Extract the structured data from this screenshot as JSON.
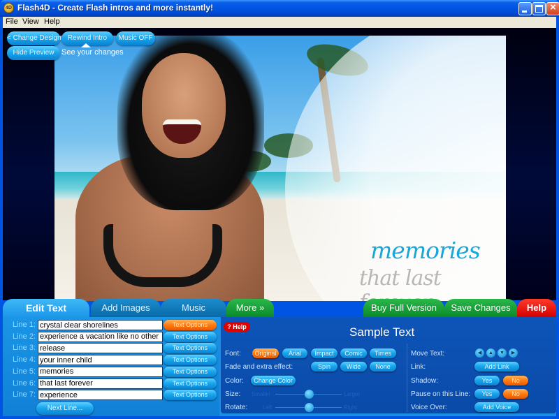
{
  "window": {
    "title": "Flash4D - Create Flash intros and more instantly!",
    "icon_label": "4D"
  },
  "menu": [
    "File",
    "View",
    "Help"
  ],
  "preview_controls": {
    "change_design": "< Change Design",
    "rewind_intro": "Rewind Intro",
    "music_off": "Music OFF",
    "hide_preview": "Hide Preview",
    "hint": "See your changes"
  },
  "preview": {
    "caption_line1": "memories",
    "caption_line2": "that last forever"
  },
  "tabs": {
    "edit_text": "Edit Text",
    "add_images": "Add Images",
    "music": "Music",
    "more": "More »",
    "buy_full_version": "Buy Full Version",
    "save_changes": "Save Changes",
    "help": "Help"
  },
  "lines": [
    {
      "label": "Line 1:",
      "value": "crystal clear shorelines",
      "options": "Text Options",
      "selected": true
    },
    {
      "label": "Line 2:",
      "value": "experience a vacation like no other",
      "options": "Text Options",
      "selected": false
    },
    {
      "label": "Line 3:",
      "value": "release",
      "options": "Text Options",
      "selected": false
    },
    {
      "label": "Line 4:",
      "value": "your inner child",
      "options": "Text Options",
      "selected": false
    },
    {
      "label": "Line 5:",
      "value": "memories",
      "options": "Text Options",
      "selected": false
    },
    {
      "label": "Line 6:",
      "value": "that last forever",
      "options": "Text Options",
      "selected": false
    },
    {
      "label": "Line 7:",
      "value": "experience",
      "options": "Text Options",
      "selected": false
    }
  ],
  "next_line": "Next Line...",
  "options_panel": {
    "help": "? Help",
    "title": "Sample Text",
    "font_label": "Font:",
    "fonts": [
      "Original",
      "Arial",
      "Impact",
      "Comic",
      "Times"
    ],
    "selected_font": "Original",
    "effect_label": "Fade and extra effect:",
    "effects": [
      "Spin",
      "Wide",
      "None"
    ],
    "color_label": "Color:",
    "change_color": "Change Color",
    "size_label": "Size:",
    "size_min": "Smaller",
    "size_max": "Larger",
    "size_value": 0.5,
    "rotate_label": "Rotate:",
    "rotate_min": "Left",
    "rotate_max": "Right",
    "rotate_value": 0.5,
    "move_text_label": "Move Text:",
    "move_arrows": [
      "left",
      "up",
      "down",
      "right"
    ],
    "link_label": "Link:",
    "add_link": "Add Link",
    "shadow_label": "Shadow:",
    "shadow_yes": "Yes",
    "shadow_no": "No",
    "shadow_selected": "No",
    "pause_label": "Pause on this Line:",
    "pause_yes": "Yes",
    "pause_no": "No",
    "pause_selected": "No",
    "voice_label": "Voice Over:",
    "add_voice": "Add Voice"
  }
}
